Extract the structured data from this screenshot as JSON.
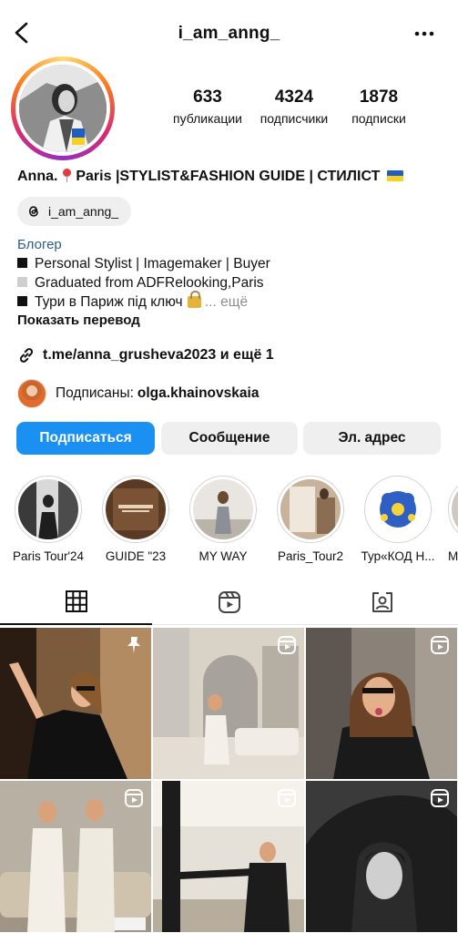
{
  "header": {
    "username": "i_am_anng_"
  },
  "profile": {
    "stats": [
      {
        "value": "633",
        "label": "публикации"
      },
      {
        "value": "4324",
        "label": "подписчики"
      },
      {
        "value": "1878",
        "label": "подписки"
      }
    ],
    "name_part1": "Anna.",
    "name_part2": "Paris |STYLIST&FASHION GUIDE | СТИЛІСТ",
    "threads_handle": "i_am_anng_",
    "category": "Блогер",
    "bio_lines": [
      "Personal Stylist | Imagemaker | Buyer",
      "Graduated from  ADFRelooking,Paris",
      "Тури в Париж під ключ"
    ],
    "bio_more": "... ещё",
    "translate_label": "Показать перевод",
    "link_text": "t.me/anna_grusheva2023 и ещё 1",
    "followed_prefix": "Подписаны:",
    "followed_user": "olga.khainovskaia"
  },
  "actions": {
    "follow_label": "Подписаться",
    "message_label": "Сообщение",
    "email_label": "Эл. адрес"
  },
  "highlights": [
    {
      "label": "Paris Tour'24"
    },
    {
      "label": "GUIDE \"23"
    },
    {
      "label": "MY WAY"
    },
    {
      "label": "Paris_Tour2"
    },
    {
      "label": "Тур«КОД Н..."
    },
    {
      "label": "M"
    }
  ],
  "tabs": [
    {
      "name": "grid-icon",
      "active": true
    },
    {
      "name": "reels-icon",
      "active": false
    },
    {
      "name": "tagged-icon",
      "active": false
    }
  ],
  "grid_posts": [
    {
      "badge": "pin-icon"
    },
    {
      "badge": "reel-icon"
    },
    {
      "badge": "reel-icon"
    },
    {
      "badge": "reel-icon"
    },
    {
      "badge": "reel-icon"
    },
    {
      "badge": "reel-icon"
    }
  ],
  "colors": {
    "accent": "#1a90f2",
    "link_blue": "#2b5e8c",
    "button_gray": "#efefef"
  }
}
